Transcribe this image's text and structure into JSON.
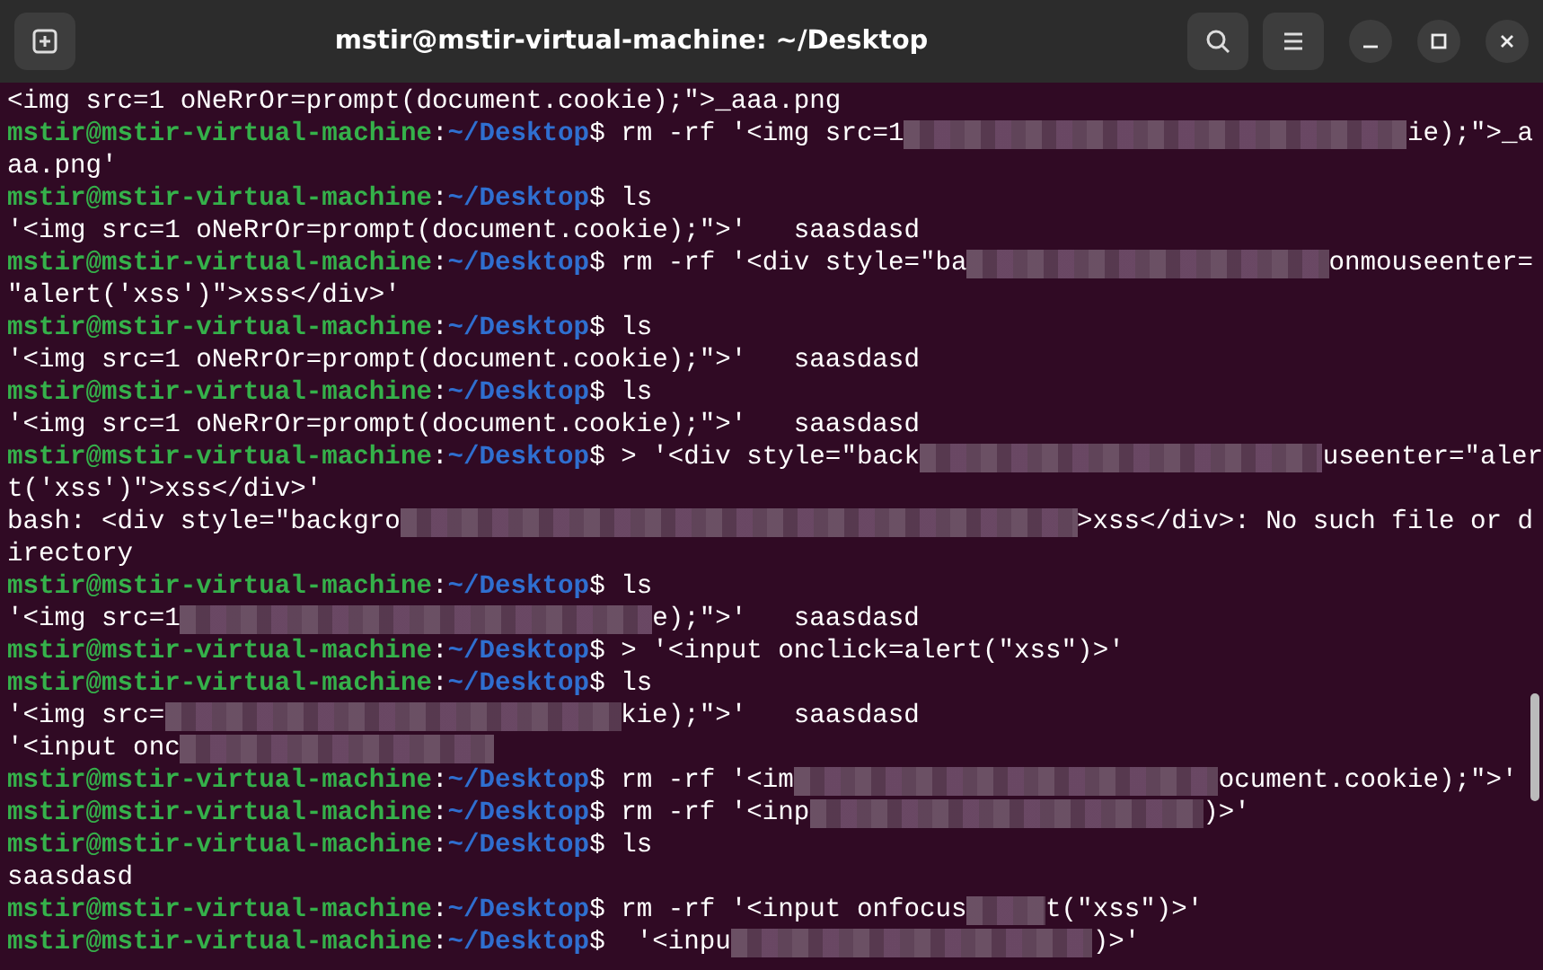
{
  "window": {
    "title": "mstir@mstir-virtual-machine: ~/Desktop"
  },
  "terminal": {
    "lines": [
      {
        "kind": "output",
        "segments": [
          {
            "kind": "text",
            "text": "<img src=1 oNeRrOr=prompt(document.cookie);\">_aaa.png"
          }
        ]
      },
      {
        "kind": "prompt",
        "user_host": "mstir@mstir-virtual-machine",
        "separator": ":",
        "path": "~/Desktop",
        "symbol": "$",
        "segments": [
          {
            "kind": "text",
            "text": " rm -rf '<img src=1"
          },
          {
            "kind": "redacted"
          },
          {
            "kind": "text",
            "text": "ie);\">_a"
          }
        ]
      },
      {
        "kind": "output",
        "segments": [
          {
            "kind": "text",
            "text": "aa.png'"
          }
        ]
      },
      {
        "kind": "prompt",
        "user_host": "mstir@mstir-virtual-machine",
        "separator": ":",
        "path": "~/Desktop",
        "symbol": "$",
        "segments": [
          {
            "kind": "text",
            "text": " ls"
          }
        ]
      },
      {
        "kind": "output",
        "segments": [
          {
            "kind": "text",
            "text": "'<img src=1 oNeRrOr=prompt(document.cookie);\">'   saasdasd"
          }
        ]
      },
      {
        "kind": "prompt",
        "user_host": "mstir@mstir-virtual-machine",
        "separator": ":",
        "path": "~/Desktop",
        "symbol": "$",
        "segments": [
          {
            "kind": "text",
            "text": " rm -rf '<div style=\"ba"
          },
          {
            "kind": "redacted"
          },
          {
            "kind": "text",
            "text": "onmouseenter="
          }
        ]
      },
      {
        "kind": "output",
        "segments": [
          {
            "kind": "text",
            "text": "\"alert('xss')\">xss</div>'"
          }
        ]
      },
      {
        "kind": "prompt",
        "user_host": "mstir@mstir-virtual-machine",
        "separator": ":",
        "path": "~/Desktop",
        "symbol": "$",
        "segments": [
          {
            "kind": "text",
            "text": " ls"
          }
        ]
      },
      {
        "kind": "output",
        "segments": [
          {
            "kind": "text",
            "text": "'<img src=1 oNeRrOr=prompt(document.cookie);\">'   saasdasd"
          }
        ]
      },
      {
        "kind": "prompt",
        "user_host": "mstir@mstir-virtual-machine",
        "separator": ":",
        "path": "~/Desktop",
        "symbol": "$",
        "segments": [
          {
            "kind": "text",
            "text": " ls"
          }
        ]
      },
      {
        "kind": "output",
        "segments": [
          {
            "kind": "text",
            "text": "'<img src=1 oNeRrOr=prompt(document.cookie);\">'   saasdasd"
          }
        ]
      },
      {
        "kind": "prompt",
        "user_host": "mstir@mstir-virtual-machine",
        "separator": ":",
        "path": "~/Desktop",
        "symbol": "$",
        "segments": [
          {
            "kind": "text",
            "text": " > '<div style=\"back"
          },
          {
            "kind": "redacted"
          },
          {
            "kind": "text",
            "text": "useenter=\"aler"
          }
        ]
      },
      {
        "kind": "output",
        "segments": [
          {
            "kind": "text",
            "text": "t('xss')\">xss</div>'"
          }
        ]
      },
      {
        "kind": "output",
        "segments": [
          {
            "kind": "text",
            "text": "bash: <div style=\"backgro"
          },
          {
            "kind": "redacted"
          },
          {
            "kind": "text",
            "text": ">xss</div>: No such file or d"
          }
        ]
      },
      {
        "kind": "output",
        "segments": [
          {
            "kind": "text",
            "text": "irectory"
          }
        ]
      },
      {
        "kind": "prompt",
        "user_host": "mstir@mstir-virtual-machine",
        "separator": ":",
        "path": "~/Desktop",
        "symbol": "$",
        "segments": [
          {
            "kind": "text",
            "text": " ls"
          }
        ]
      },
      {
        "kind": "output",
        "segments": [
          {
            "kind": "text",
            "text": "'<img src=1"
          },
          {
            "kind": "redacted"
          },
          {
            "kind": "text",
            "text": "e);\">'   saasdasd"
          }
        ]
      },
      {
        "kind": "prompt",
        "user_host": "mstir@mstir-virtual-machine",
        "separator": ":",
        "path": "~/Desktop",
        "symbol": "$",
        "segments": [
          {
            "kind": "text",
            "text": " > '<input onclick=alert(\"xss\")>'"
          }
        ]
      },
      {
        "kind": "prompt",
        "user_host": "mstir@mstir-virtual-machine",
        "separator": ":",
        "path": "~/Desktop",
        "symbol": "$",
        "segments": [
          {
            "kind": "text",
            "text": " ls"
          }
        ]
      },
      {
        "kind": "output",
        "segments": [
          {
            "kind": "text",
            "text": "'<img src="
          },
          {
            "kind": "redacted"
          },
          {
            "kind": "text",
            "text": "kie);\">'   saasdasd"
          }
        ]
      },
      {
        "kind": "output",
        "segments": [
          {
            "kind": "text",
            "text": "'<input onc"
          },
          {
            "kind": "redacted"
          }
        ]
      },
      {
        "kind": "prompt",
        "user_host": "mstir@mstir-virtual-machine",
        "separator": ":",
        "path": "~/Desktop",
        "symbol": "$",
        "segments": [
          {
            "kind": "text",
            "text": " rm -rf '<im"
          },
          {
            "kind": "redacted"
          },
          {
            "kind": "text",
            "text": "ocument.cookie);\">'"
          }
        ]
      },
      {
        "kind": "prompt",
        "user_host": "mstir@mstir-virtual-machine",
        "separator": ":",
        "path": "~/Desktop",
        "symbol": "$",
        "segments": [
          {
            "kind": "text",
            "text": " rm -rf '<inp"
          },
          {
            "kind": "redacted"
          },
          {
            "kind": "text",
            "text": ")>'"
          }
        ]
      },
      {
        "kind": "prompt",
        "user_host": "mstir@mstir-virtual-machine",
        "separator": ":",
        "path": "~/Desktop",
        "symbol": "$",
        "segments": [
          {
            "kind": "text",
            "text": " ls"
          }
        ]
      },
      {
        "kind": "output",
        "segments": [
          {
            "kind": "text",
            "text": "saasdasd"
          }
        ]
      },
      {
        "kind": "prompt",
        "user_host": "mstir@mstir-virtual-machine",
        "separator": ":",
        "path": "~/Desktop",
        "symbol": "$",
        "segments": [
          {
            "kind": "text",
            "text": " rm -rf '<input onfocus"
          },
          {
            "kind": "redacted"
          },
          {
            "kind": "text",
            "text": "t(\"xss\")>'"
          }
        ]
      },
      {
        "kind": "prompt",
        "user_host": "mstir@mstir-virtual-machine",
        "separator": ":",
        "path": "~/Desktop",
        "symbol": "$",
        "segments": [
          {
            "kind": "text",
            "text": "  '<inpu"
          },
          {
            "kind": "redacted"
          },
          {
            "kind": "text",
            "text": ")>'"
          }
        ]
      }
    ]
  }
}
